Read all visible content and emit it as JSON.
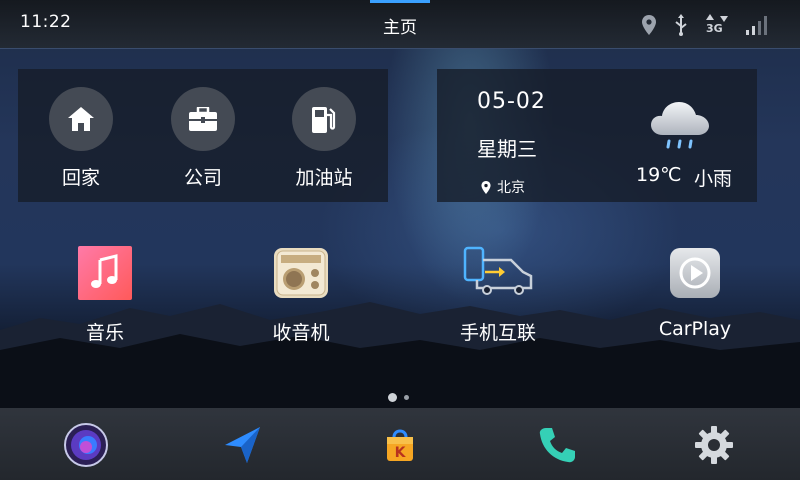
{
  "status_bar": {
    "time": "11:22",
    "title": "主页",
    "network_label": "3G",
    "icons": [
      "location-pin-icon",
      "usb-icon",
      "network-3g-icon",
      "signal-strength-icon"
    ]
  },
  "shortcuts": [
    {
      "label": "回家",
      "icon": "home-icon"
    },
    {
      "label": "公司",
      "icon": "briefcase-icon"
    },
    {
      "label": "加油站",
      "icon": "gas-station-icon"
    }
  ],
  "weather": {
    "date": "05-02",
    "weekday": "星期三",
    "city": "北京",
    "temperature": "19℃",
    "condition": "小雨",
    "icon": "rain-cloud-icon"
  },
  "apps": [
    {
      "label": "音乐",
      "icon": "music-icon"
    },
    {
      "label": "收音机",
      "icon": "radio-icon"
    },
    {
      "label": "手机互联",
      "icon": "phone-link-icon"
    },
    {
      "label": "CarPlay",
      "icon": "carplay-icon"
    }
  ],
  "pager": {
    "pages": 2,
    "current": 1
  },
  "dock": [
    "voice-assistant-icon",
    "navigation-icon",
    "app-store-icon",
    "phone-icon",
    "settings-icon"
  ],
  "colors": {
    "accent": "#3aa0ff",
    "card_bg": "#161c28",
    "dock_bg": "#2a2e35"
  }
}
